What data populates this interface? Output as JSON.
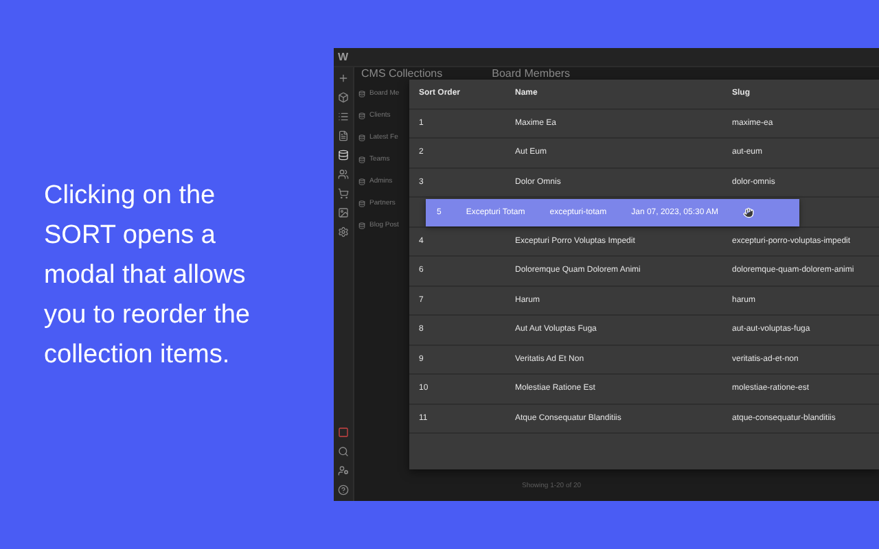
{
  "caption": "Clicking on the SORT opens a modal that allows you to reorder the collection items.",
  "app": {
    "logo": "W",
    "header": {
      "title": "CMS Collections",
      "subtitle": "Board Members"
    },
    "sidebar": {
      "items": [
        "Board Me",
        "Clients",
        "Latest Fe",
        "Teams",
        "Admins",
        "Partners",
        "Blog Post"
      ]
    },
    "modal": {
      "columns": [
        "Sort Order",
        "Name",
        "Slug"
      ],
      "rows": [
        {
          "kind": "row",
          "cells": [
            "1",
            "Maxime Ea",
            "maxime-ea"
          ]
        },
        {
          "kind": "row",
          "cells": [
            "2",
            "Aut Eum",
            "aut-eum"
          ]
        },
        {
          "kind": "row",
          "cells": [
            "3",
            "Dolor Omnis",
            "dolor-omnis"
          ]
        },
        {
          "kind": "dragging",
          "cells": [
            "5",
            "Excepturi Totam",
            "excepturi-totam",
            "Jan 07, 2023, 05:30 AM"
          ]
        },
        {
          "kind": "row",
          "cells": [
            "4",
            "Excepturi Porro Voluptas Impedit",
            "excepturi-porro-voluptas-impedit"
          ]
        },
        {
          "kind": "row",
          "cells": [
            "6",
            "Doloremque Quam Dolorem Animi",
            "doloremque-quam-dolorem-animi"
          ]
        },
        {
          "kind": "row",
          "cells": [
            "7",
            "Harum",
            "harum"
          ]
        },
        {
          "kind": "row",
          "cells": [
            "8",
            "Aut Aut Voluptas Fuga",
            "aut-aut-voluptas-fuga"
          ]
        },
        {
          "kind": "row",
          "cells": [
            "9",
            "Veritatis Ad Et Non",
            "veritatis-ad-et-non"
          ]
        },
        {
          "kind": "row",
          "cells": [
            "10",
            "Molestiae Ratione Est",
            "molestiae-ratione-est"
          ]
        },
        {
          "kind": "row",
          "cells": [
            "11",
            "Atque Consequatur Blanditiis",
            "atque-consequatur-blanditiis"
          ]
        }
      ]
    },
    "footer": "Showing 1-20 of 20"
  }
}
